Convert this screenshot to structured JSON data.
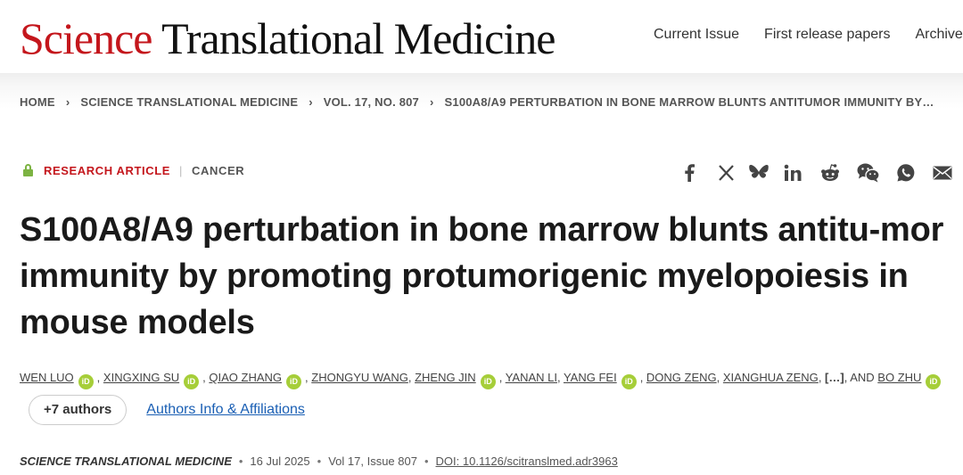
{
  "header": {
    "logo_science": "Science",
    "logo_rest": "Translational Medicine",
    "nav": [
      "Current Issue",
      "First release papers",
      "Archive"
    ]
  },
  "breadcrumb": [
    "HOME",
    "SCIENCE TRANSLATIONAL MEDICINE",
    "VOL. 17, NO. 807",
    "S100A8/A9 PERTURBATION IN BONE MARROW BLUNTS ANTITUMOR IMMUNITY BY…"
  ],
  "article": {
    "type": "RESEARCH ARTICLE",
    "subject": "CANCER",
    "title": "S100A8/A9 perturbation in bone marrow blunts antitu-mor immunity by promoting protumorigenic myelopoiesis in mouse models",
    "access_icon": "open-lock-icon"
  },
  "share_icons": [
    "facebook-icon",
    "x-icon",
    "bluesky-icon",
    "linkedin-icon",
    "reddit-icon",
    "wechat-icon",
    "whatsapp-icon",
    "email-icon"
  ],
  "authors": {
    "list": [
      "Wen Luo",
      "Xingxing Su",
      "Qiao Zhang",
      "Zhongyu Wang",
      "Zheng Jin",
      "Yanan Li",
      "Yang Fei",
      "Dong Zeng",
      "Xianghua Zeng"
    ],
    "ellipsis": "[…]",
    "and": ", AND ",
    "last": "Bo Zhu",
    "orcid_badge": "iD",
    "more_button": "+7 authors",
    "affiliations_link": "Authors Info & Affiliations"
  },
  "citation": {
    "journal": "Science Translational Medicine",
    "date": "16 Jul 2025",
    "volume_issue": "Vol 17, Issue 807",
    "doi": "DOI: 10.1126/scitranslmed.adr3963"
  },
  "colors": {
    "brand_red": "#c4161c",
    "orcid_green": "#a6ce39",
    "lock_green": "#7cb342",
    "link_blue": "#1a5fb4"
  }
}
